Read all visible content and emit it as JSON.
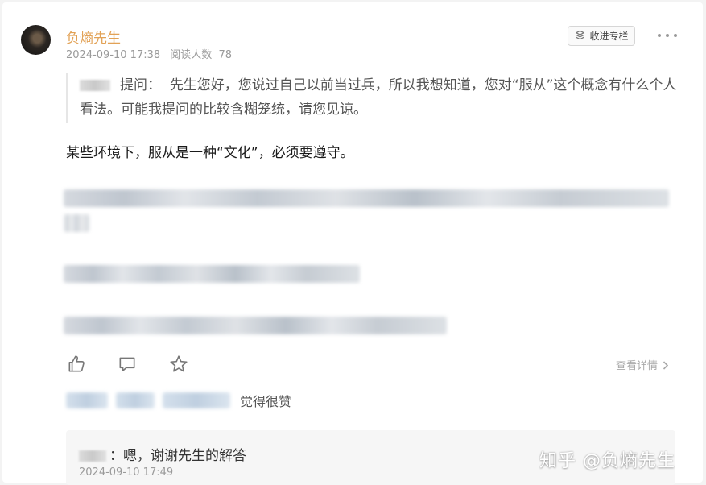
{
  "post": {
    "author": "负熵先生",
    "date": "2024-09-10 17:38",
    "reads_label": "阅读人数",
    "reads_count": "78",
    "follow_label": "收进专栏"
  },
  "question": {
    "prefix": "提问：",
    "text": "先生您好，您说过自己以前当过兵，所以我想知道，您对“服从”这个概念有什么个人看法。可能我提问的比较含糊笼统，请您见谅。"
  },
  "answer": {
    "text": "某些环境下，服从是一种“文化”，必须要遵守。"
  },
  "footer": {
    "detail_label": "查看详情",
    "likes_text": "觉得很赞"
  },
  "reply": {
    "text": "：嗯，谢谢先生的解答",
    "time": "2024-09-10 17:49"
  },
  "watermark": "知乎 @负熵先生",
  "icons": {
    "like": "thumbs-up-icon",
    "comment": "comment-icon",
    "favorite": "star-icon",
    "more": "more-dots-icon",
    "follow": "collection-icon"
  },
  "colors": {
    "author": "#e2a256",
    "meta": "#9a9a9a",
    "background": "#f3f3f3"
  }
}
